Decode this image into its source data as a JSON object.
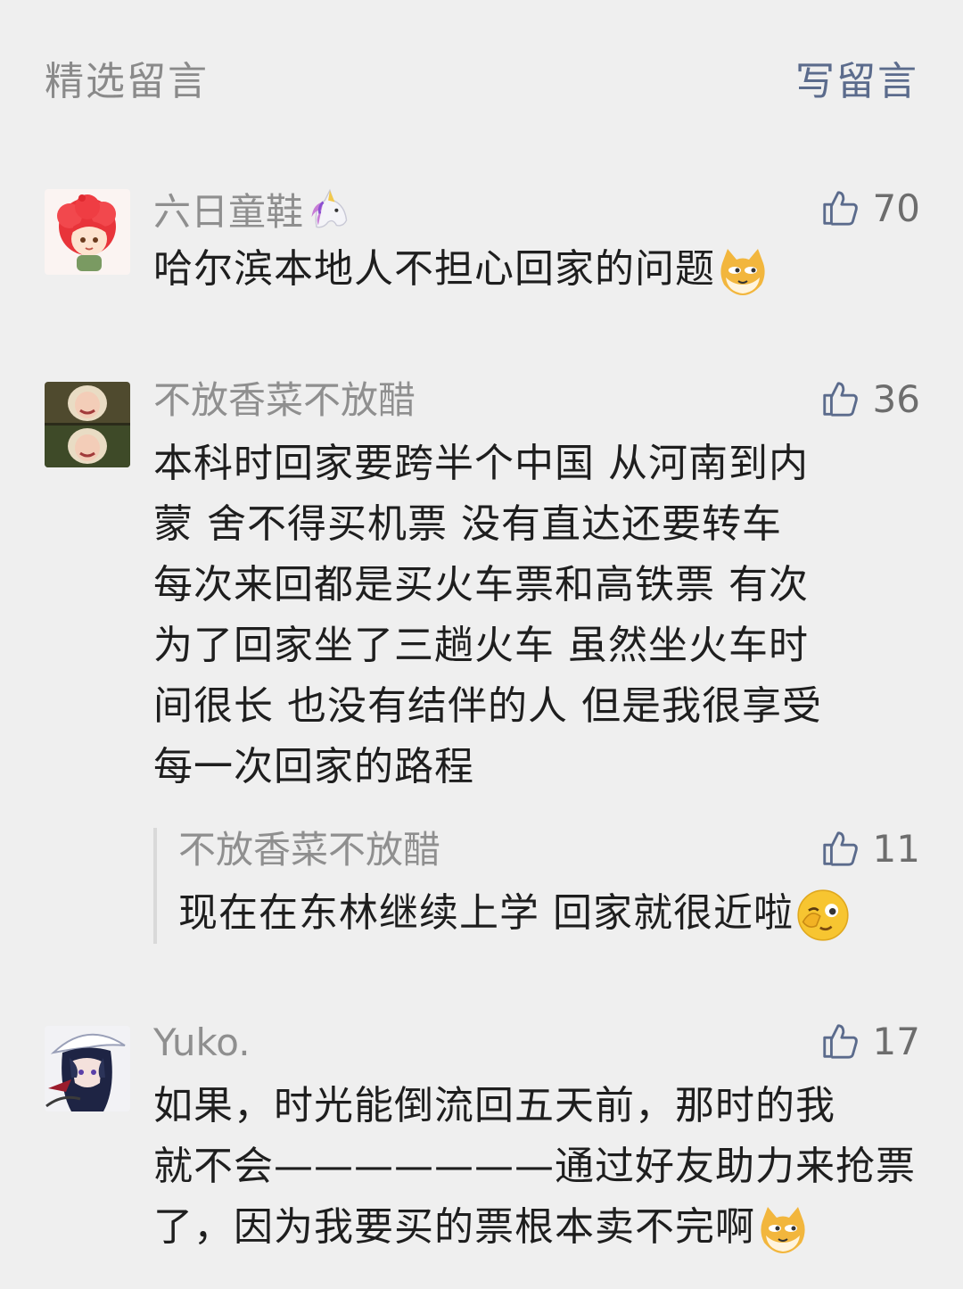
{
  "header": {
    "title": "精选留言",
    "write_label": "写留言"
  },
  "comments": [
    {
      "nickname": "六日童鞋",
      "likes": "70",
      "lines": [
        "哈尔滨本地人不担心回家的问题"
      ],
      "avatar": "red-hair-cartoon-avatar",
      "name_emoji": "unicorn-icon",
      "end_emoji": "doge-icon"
    },
    {
      "nickname": "不放香菜不放醋",
      "likes": "36",
      "lines": [
        "本科时回家要跨半个中国 从河南到内",
        "蒙 舍不得买机票  没有直达还要转车",
        "每次来回都是买火车票和高铁票  有次",
        "为了回家坐了三趟火车 虽然坐火车时",
        "间很长 也没有结伴的人 但是我很享受",
        "每一次回家的路程"
      ],
      "avatar": "photo-avatar",
      "reply": {
        "nickname": "不放香菜不放醋",
        "likes": "11",
        "text": "现在在东林继续上学 回家就很近啦",
        "end_emoji": "wink-icon"
      }
    },
    {
      "nickname": "Yuko.",
      "likes": "17",
      "lines": [
        "如果，时光能倒流回五天前，那时的我",
        "就不会———————通过好友助力来抢票",
        "了，因为我要买的票根本卖不完啊"
      ],
      "avatar": "anime-avatar",
      "end_emoji": "doge-icon"
    }
  ],
  "colors": {
    "background": "#efefef",
    "link": "#5b6b8c",
    "meta": "#8f8f8f",
    "text": "#1e1e1e"
  }
}
